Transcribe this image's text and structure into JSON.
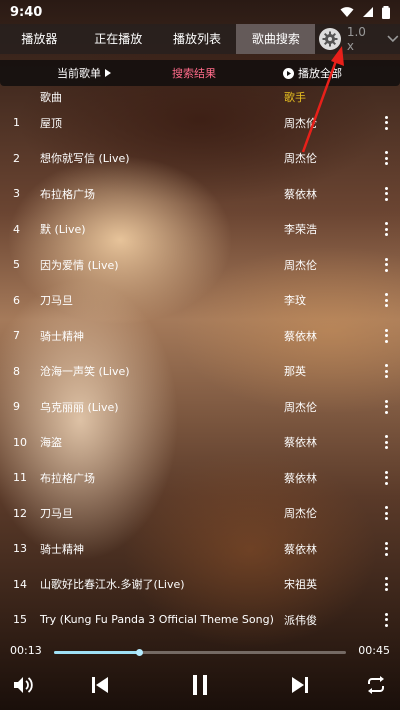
{
  "status": {
    "time": "9:40"
  },
  "tabs": [
    {
      "label": "播放器",
      "active": false
    },
    {
      "label": "正在播放",
      "active": false
    },
    {
      "label": "播放列表",
      "active": false
    },
    {
      "label": "歌曲搜索",
      "active": true
    }
  ],
  "speed": "1.0 x",
  "subnav": {
    "current": "当前歌单",
    "result": "搜索结果",
    "playall": "播放全部"
  },
  "header": {
    "song": "歌曲",
    "artist": "歌手"
  },
  "songs": [
    {
      "num": "1",
      "title": "屋顶",
      "artist": "周杰伦"
    },
    {
      "num": "2",
      "title": "想你就写信 (Live)",
      "artist": "周杰伦"
    },
    {
      "num": "3",
      "title": "布拉格广场",
      "artist": "蔡依林"
    },
    {
      "num": "4",
      "title": "默 (Live)",
      "artist": "李荣浩"
    },
    {
      "num": "5",
      "title": "因为爱情 (Live)",
      "artist": "周杰伦"
    },
    {
      "num": "6",
      "title": "刀马旦",
      "artist": "李玟"
    },
    {
      "num": "7",
      "title": "骑士精神",
      "artist": "蔡依林"
    },
    {
      "num": "8",
      "title": "沧海一声笑 (Live)",
      "artist": "那英"
    },
    {
      "num": "9",
      "title": "乌克丽丽 (Live)",
      "artist": "周杰伦"
    },
    {
      "num": "10",
      "title": "海盗",
      "artist": "蔡依林"
    },
    {
      "num": "11",
      "title": "布拉格广场",
      "artist": "蔡依林"
    },
    {
      "num": "12",
      "title": "刀马旦",
      "artist": "周杰伦"
    },
    {
      "num": "13",
      "title": "骑士精神",
      "artist": "蔡依林"
    },
    {
      "num": "14",
      "title": "山歌好比春江水.多谢了(Live)",
      "artist": "宋祖英"
    },
    {
      "num": "15",
      "title": "Try (Kung Fu Panda 3 Official Theme Song)",
      "artist": "派伟俊"
    }
  ],
  "player": {
    "current_time": "00:13",
    "total_time": "00:45",
    "progress": 0.29
  },
  "colors": {
    "accent_pink": "#ff6b8a",
    "accent_yellow": "#e8c020",
    "progress": "#9fe0f5",
    "annotation_arrow": "#e8201a"
  }
}
